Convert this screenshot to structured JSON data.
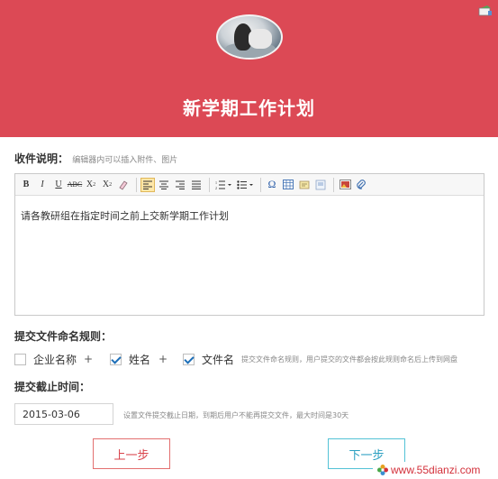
{
  "header": {
    "title": "新学期工作计划",
    "background_color": "#dc4955"
  },
  "collect": {
    "label": "收件说明：",
    "hint": "编辑器内可以插入附件、图片",
    "content": "请各教研组在指定时间之前上交新学期工作计划",
    "toolbar_icons": [
      "bold-icon",
      "italic-icon",
      "underline-icon",
      "strikethrough-icon",
      "superscript-icon",
      "subscript-icon",
      "eraser-icon",
      "align-left-icon",
      "align-center-icon",
      "align-right-icon",
      "align-justify-icon",
      "ordered-list-icon",
      "unordered-list-icon",
      "special-char-icon",
      "table-icon",
      "emotion-icon",
      "template-icon",
      "image-icon",
      "attachment-icon"
    ]
  },
  "naming": {
    "label": "提交文件命名规则：",
    "options": [
      {
        "label": "企业名称",
        "checked": false
      },
      {
        "label": "姓名",
        "checked": true
      },
      {
        "label": "文件名",
        "checked": true
      }
    ],
    "plus": "+",
    "hint": "提交文件命名规则，用户提交的文件都会按此规则命名后上传到网盘"
  },
  "deadline": {
    "label": "提交截止时间：",
    "value": "2015-03-06",
    "hint": "设置文件提交截止日期，到期后用户不能再提交文件，最大时间是30天"
  },
  "buttons": {
    "prev": "上一步",
    "next": "下一步"
  },
  "watermark": {
    "text": "www.55dianzi.com"
  }
}
